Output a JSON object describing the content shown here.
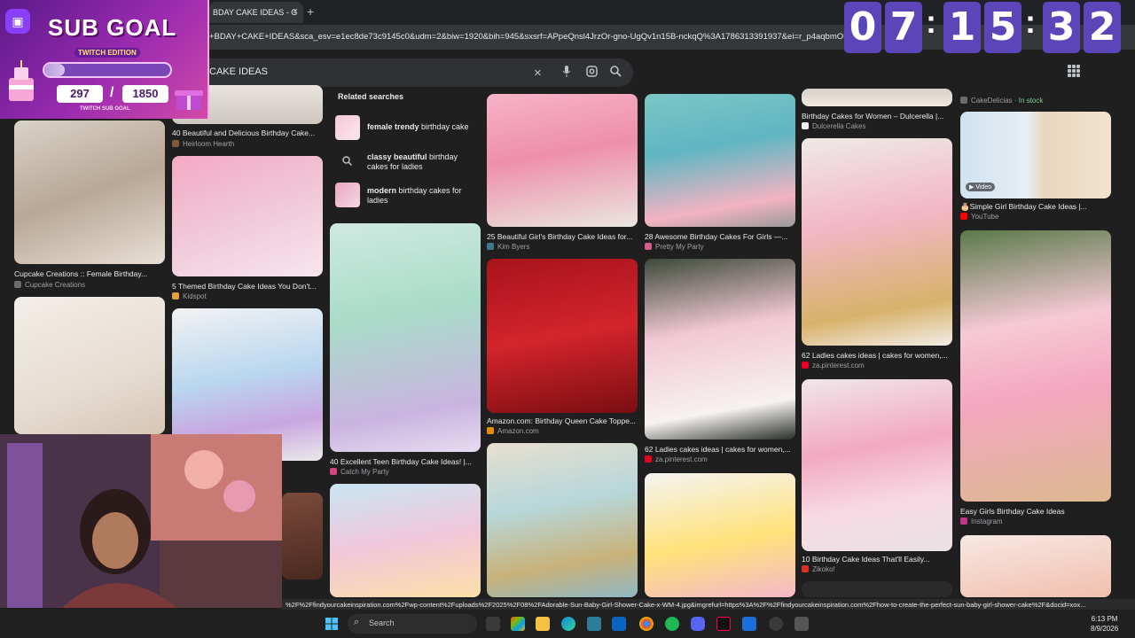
{
  "browser": {
    "tab_title": "BDAY CAKE IDEAS - G",
    "tab_close": "×",
    "new_tab": "+",
    "url": "+BDAY+CAKE+IDEAS&sca_esv=e1ec8de73c9145c0&udm=2&biw=1920&bih=945&sxsrf=APpeQnsl4JrzOr-gno-UgQv1n15B-nckqQ%3A1786313391937&ei=r_p4aqbmOKem",
    "bookmark_fragment": "KE"
  },
  "search": {
    "query": "CAKE IDEAS",
    "clear_icon": "×",
    "mic_icon": "mic-icon",
    "lens_icon": "lens-icon",
    "search_icon": "search-icon"
  },
  "related": {
    "title": "Related searches",
    "items": [
      {
        "bold": "female trendy",
        "rest": " birthday cake"
      },
      {
        "bold": "classy beautiful",
        "rest": " birthday cakes for ladies"
      },
      {
        "bold": "modern",
        "rest": " birthday cakes for ladies"
      }
    ]
  },
  "results": [
    {
      "caption": "40 Beautiful and Delicious Birthday Cake...",
      "source": "Heirloom Hearth"
    },
    {
      "caption": "Cupcake Creations :: Female Birthday...",
      "source": "Cupcake Creations"
    },
    {
      "caption": "5 Themed Birthday Cake Ideas You Don't...",
      "source": "Kidspot"
    },
    {
      "caption": "25 Beautiful Girl's Birthday Cake Ideas for...",
      "source": "Kim Byers"
    },
    {
      "caption": "28 Awesome Birthday Cakes For Girls —...",
      "source": "Pretty My Party"
    },
    {
      "caption": "Birthday Cakes for Women – Dulcerella |...",
      "source": "Dulcerella Cakes"
    },
    {
      "caption": "40 Excellent Teen Birthday Cake Ideas! |...",
      "source": "Catch My Party"
    },
    {
      "caption": "Amazon.com: Birthday Queen Cake Toppe...",
      "source": "Amazon.com"
    },
    {
      "caption": "62 Ladies cakes ideas | cakes for women,...",
      "source": "za.pinterest.com"
    },
    {
      "caption": "62 Ladies cakes ideas | cakes for women,...",
      "source": "za.pinterest.com"
    },
    {
      "caption": "10 Birthday Cake Ideas That'll Easily...",
      "source": "Zikoko!"
    },
    {
      "caption": "🎂Simple Girl Birthday Cake Ideas |...",
      "source": "YouTube"
    },
    {
      "caption": "Easy Girls Birthday Cake Ideas",
      "source": "Instagram"
    }
  ],
  "cake_delicias": {
    "source": "CakeDelicias",
    "stock": "In stock"
  },
  "video_badge": "Video",
  "sub_goal": {
    "title": "SUB GOAL",
    "edition": "TWITCH EDITION",
    "current": "297",
    "slash": "/",
    "goal": "1850",
    "progress": 0.16,
    "footer": "TWITCH SUB GOAL"
  },
  "timer": {
    "h1": "0",
    "h2": "7",
    "m1": "1",
    "m2": "5",
    "s1": "3",
    "s2": "2",
    "sep": ":"
  },
  "status_url": "%2F%2Ffindyourcakeinspiration.com%2Fwp-content%2Fuploads%2F2025%2F08%2FAdorable-Sun-Baby-Girl-Shower-Cake-x-WM-4.jpg&imgrefurl=https%3A%2F%2Ffindyourcakeinspiration.com%2Fhow-to-create-the-perfect-sun-baby-girl-shower-cake%2F&docid=xox...",
  "taskbar": {
    "search": "Search",
    "time": "6:13 PM",
    "date": "8/9/2026"
  },
  "colors": {
    "accent": "#8a3ffc",
    "timer": "#5b45b8",
    "stock": "#81c995"
  }
}
